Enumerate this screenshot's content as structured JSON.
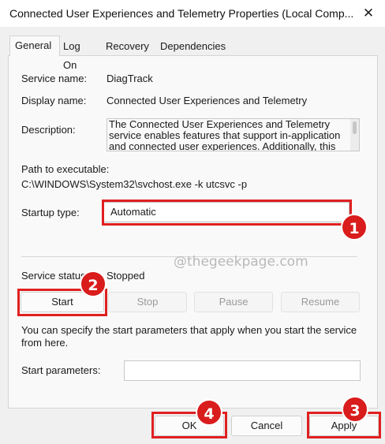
{
  "window": {
    "title": "Connected User Experiences and Telemetry Properties (Local Comp...",
    "close_glyph": "✕"
  },
  "tabs": [
    {
      "label": "General",
      "active": true
    },
    {
      "label": "Log On"
    },
    {
      "label": "Recovery"
    },
    {
      "label": "Dependencies"
    }
  ],
  "general": {
    "service_name_label": "Service name:",
    "service_name_value": "DiagTrack",
    "display_name_label": "Display name:",
    "display_name_value": "Connected User Experiences and Telemetry",
    "description_label": "Description:",
    "description_value": "The Connected User Experiences and Telemetry service enables features that support in-application and connected user experiences. Additionally, this",
    "path_label": "Path to executable:",
    "path_value": "C:\\WINDOWS\\System32\\svchost.exe -k utcsvc -p",
    "startup_type_label": "Startup type:",
    "startup_type_value": "Automatic",
    "service_status_label": "Service status:",
    "service_status_value": "Stopped",
    "start_button": "Start",
    "stop_button": "Stop",
    "pause_button": "Pause",
    "resume_button": "Resume",
    "start_params_hint": "You can specify the start parameters that apply when you start the service from here.",
    "start_params_label": "Start parameters:",
    "start_params_value": ""
  },
  "watermark": "@thegeekpage.com",
  "footer": {
    "ok_button": "OK",
    "cancel_button": "Cancel",
    "apply_button": "Apply"
  },
  "annotations": {
    "marker_1": "1",
    "marker_2": "2",
    "marker_3": "3",
    "marker_4": "4",
    "highlight_color": "#e02020"
  }
}
